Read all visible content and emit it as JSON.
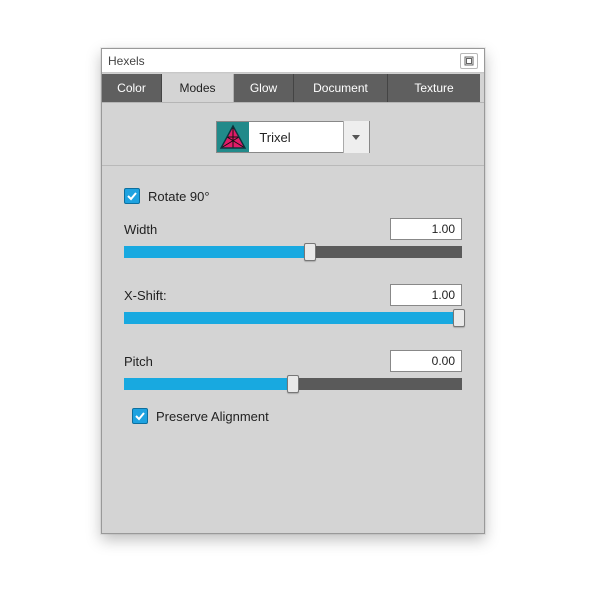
{
  "window": {
    "title": "Hexels"
  },
  "tabs": {
    "items": [
      "Color",
      "Modes",
      "Glow",
      "Document",
      "Texture"
    ],
    "active_index": 1
  },
  "mode": {
    "selected": "Trixel"
  },
  "checkboxes": {
    "rotate90": {
      "label": "Rotate 90°",
      "checked": true
    },
    "preserve_alignment": {
      "label": "Preserve Alignment",
      "checked": true
    }
  },
  "sliders": {
    "width": {
      "label": "Width",
      "value": "1.00",
      "fill_pct": 55
    },
    "xshift": {
      "label": "X-Shift:",
      "value": "1.00",
      "fill_pct": 99
    },
    "pitch": {
      "label": "Pitch",
      "value": "0.00",
      "fill_pct": 50
    }
  },
  "colors": {
    "accent": "#18a9e0"
  }
}
